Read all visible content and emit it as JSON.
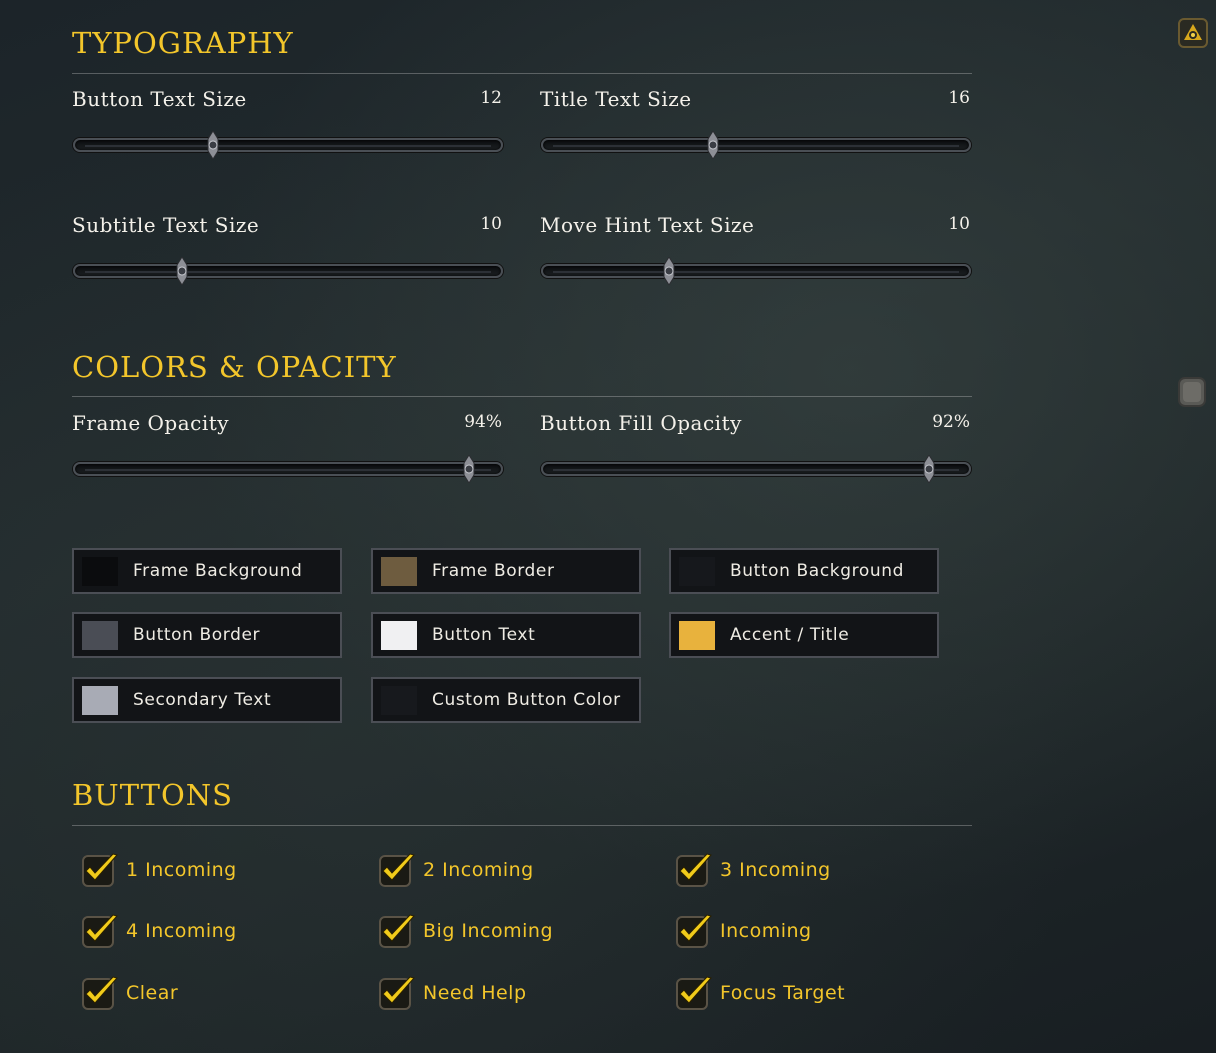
{
  "sections": {
    "typography": "TYPOGRAPHY",
    "colors": "COLORS & OPACITY",
    "buttons": "BUTTONS"
  },
  "sliders": [
    {
      "label": "Button Text Size",
      "value": "12",
      "fraction": 0.31
    },
    {
      "label": "Title Text Size",
      "value": "16",
      "fraction": 0.39
    },
    {
      "label": "Subtitle Text Size",
      "value": "10",
      "fraction": 0.235
    },
    {
      "label": "Move Hint Text Size",
      "value": "10",
      "fraction": 0.28
    },
    {
      "label": "Frame Opacity",
      "value": "94%",
      "fraction": 0.94
    },
    {
      "label": "Button Fill Opacity",
      "value": "92%",
      "fraction": 0.92
    }
  ],
  "swatches": [
    {
      "label": "Frame Background",
      "color": "#0b0c0e"
    },
    {
      "label": "Frame Border",
      "color": "#6e5c3f"
    },
    {
      "label": "Button Background",
      "color": "#16181c"
    },
    {
      "label": "Button Border",
      "color": "#4a4d55"
    },
    {
      "label": "Button Text",
      "color": "#f0f0f2"
    },
    {
      "label": "Accent / Title",
      "color": "#e8b23d"
    },
    {
      "label": "Secondary Text",
      "color": "#a8abb5"
    },
    {
      "label": "Custom Button Color",
      "color": "#17191d"
    }
  ],
  "buttons": [
    {
      "label": "1 Incoming",
      "checked": true
    },
    {
      "label": "2 Incoming",
      "checked": true
    },
    {
      "label": "3 Incoming",
      "checked": true
    },
    {
      "label": "4 Incoming",
      "checked": true
    },
    {
      "label": "Big Incoming",
      "checked": true
    },
    {
      "label": "Incoming",
      "checked": true
    },
    {
      "label": "Clear",
      "checked": true
    },
    {
      "label": "Need Help",
      "checked": true
    },
    {
      "label": "Focus Target",
      "checked": true
    }
  ],
  "colors": {
    "accent": "#f3c62b",
    "text": "#f4f1ea"
  },
  "icons": {
    "top_right": "minimap-tracking-icon",
    "mid_right": "scroll-handle-icon"
  }
}
